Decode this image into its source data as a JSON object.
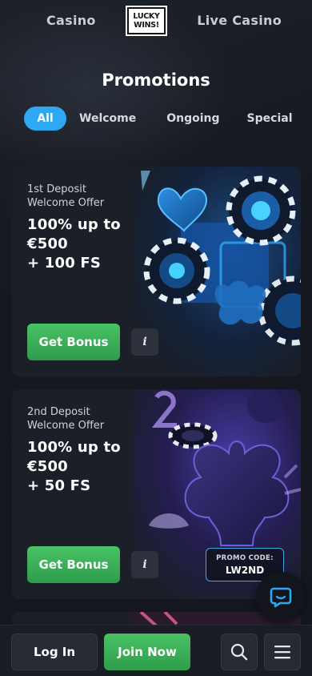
{
  "nav": {
    "left_link": "Casino",
    "logo_line1": "LUCKY",
    "logo_line2": "WINS!",
    "right_link": "Live Casino"
  },
  "page_title": "Promotions",
  "tabs": [
    {
      "label": "All",
      "active": true
    },
    {
      "label": "Welcome",
      "active": false
    },
    {
      "label": "Ongoing",
      "active": false
    },
    {
      "label": "Special",
      "active": false
    }
  ],
  "promos": [
    {
      "subtitle_line1": "1st Deposit",
      "subtitle_line2": "Welcome Offer",
      "title_line1": "100% up to",
      "title_line2": "€500",
      "title_line3": "+ 100 FS",
      "cta": "Get Bonus",
      "info": "i",
      "art": "blue neon heart and casino chips"
    },
    {
      "subtitle_line1": "2nd Deposit",
      "subtitle_line2": "Welcome Offer",
      "title_line1": "100% up to",
      "title_line2": "€500",
      "title_line3": "+ 50 FS",
      "cta": "Get Bonus",
      "info": "i",
      "promo_code_label": "PROMO CODE:",
      "promo_code_value": "LW2ND",
      "art": "purple neon club and casino chip"
    }
  ],
  "bottom_bar": {
    "login": "Log In",
    "join": "Join Now",
    "search_icon": "search-icon",
    "menu_icon": "hamburger-menu-icon"
  },
  "chat_icon": "chat-bubble-icon",
  "colors": {
    "background": "#15181f",
    "accent_blue": "#2fa8f2",
    "cta_green": "#3bb05a",
    "card_bg": "#1b1f27"
  }
}
